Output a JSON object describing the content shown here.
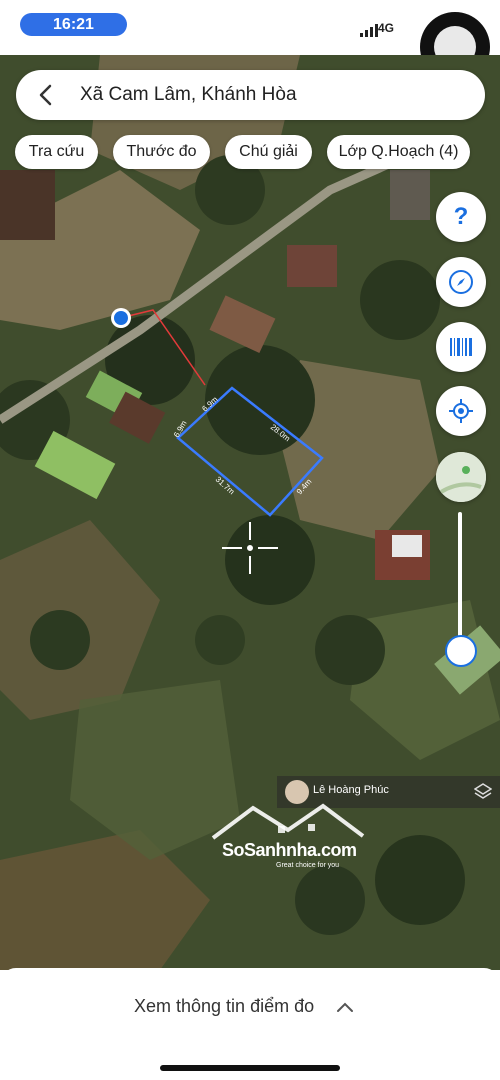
{
  "status": {
    "time": "16:21",
    "network": "4G"
  },
  "search": {
    "location": "Xã Cam Lâm, Khánh Hòa"
  },
  "chips": [
    "Tra cứu",
    "Thước đo",
    "Chú giải",
    "Lớp Q.Hoạch (4)"
  ],
  "tools": {
    "help_label": "?"
  },
  "measurements": [
    "6.9m",
    "28.0m",
    "9.4m",
    "31.7m",
    "6.9m"
  ],
  "watermark": {
    "user": "Lê Hoàng Phúc",
    "brand": "SoSanhnha.com",
    "tagline": "Great choice for you"
  },
  "bottom_sheet": {
    "label": "Xem thông tin điểm đo"
  },
  "colors": {
    "accent": "#1a6fe0",
    "measure_line": "#3a7bff",
    "boundary": "#e23a3a"
  }
}
